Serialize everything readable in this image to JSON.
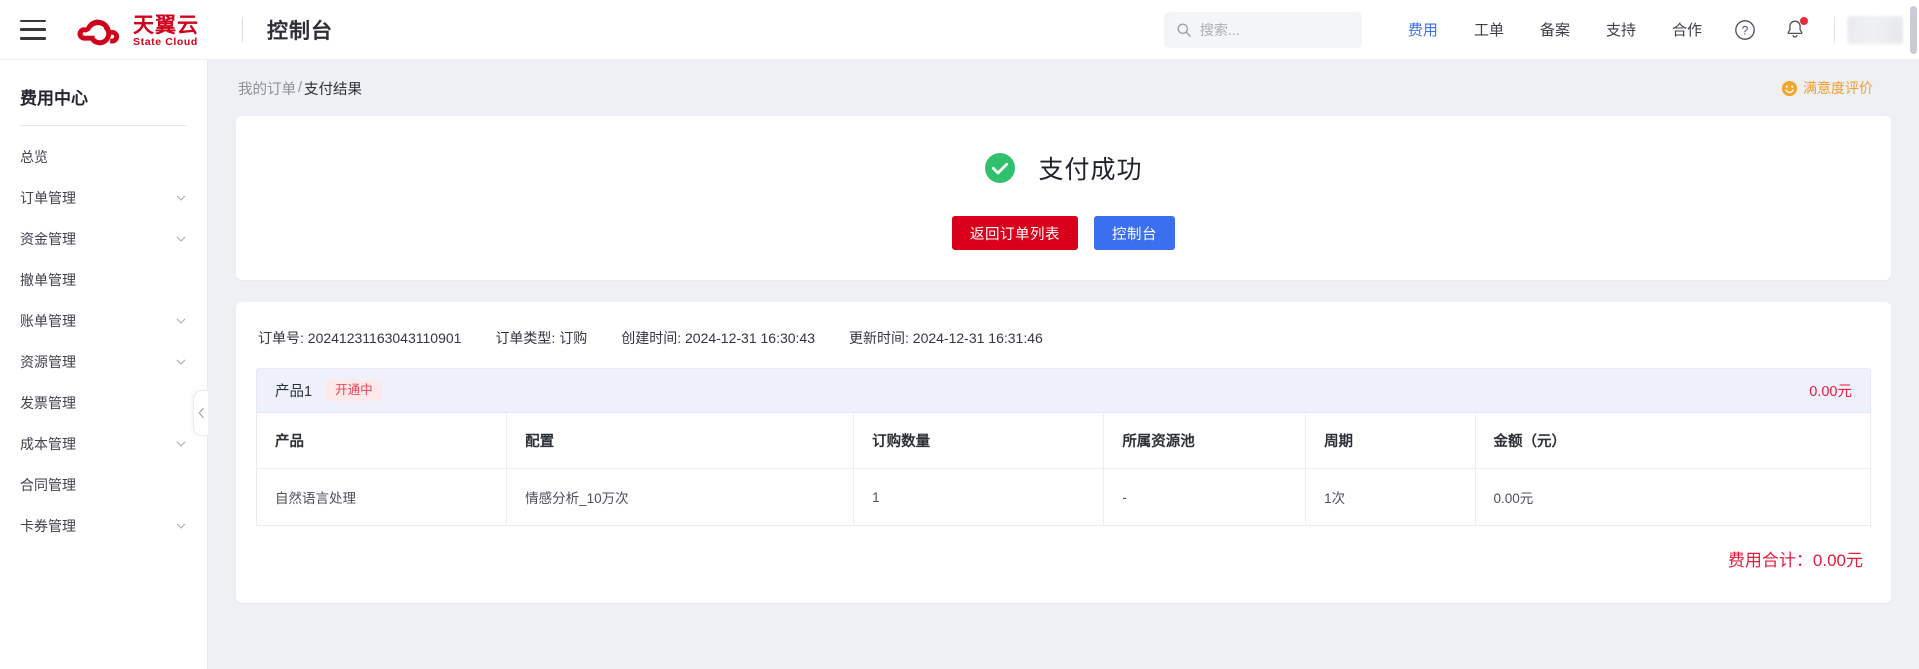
{
  "topbar": {
    "menu_icon": "hamburger-icon",
    "brand_primary": "天翼云",
    "brand_secondary": "State Cloud",
    "console_title": "控制台",
    "search": {
      "placeholder": "搜索...",
      "value": "",
      "icon": "search-icon"
    },
    "nav": [
      {
        "label": "费用",
        "active": true
      },
      {
        "label": "工单",
        "active": false
      },
      {
        "label": "备案",
        "active": false
      },
      {
        "label": "支持",
        "active": false
      },
      {
        "label": "合作",
        "active": false
      }
    ],
    "help_icon": "question-circle-icon",
    "notification_icon": "bell-icon",
    "has_notification": true,
    "avatar": "user-avatar"
  },
  "sidebar": {
    "title": "费用中心",
    "items": [
      {
        "label": "总览",
        "expandable": false
      },
      {
        "label": "订单管理",
        "expandable": true
      },
      {
        "label": "资金管理",
        "expandable": true
      },
      {
        "label": "撤单管理",
        "expandable": false
      },
      {
        "label": "账单管理",
        "expandable": true
      },
      {
        "label": "资源管理",
        "expandable": true
      },
      {
        "label": "发票管理",
        "expandable": false
      },
      {
        "label": "成本管理",
        "expandable": true
      },
      {
        "label": "合同管理",
        "expandable": false
      },
      {
        "label": "卡券管理",
        "expandable": true
      }
    ],
    "collapse_icon": "chevron-left-icon"
  },
  "breadcrumb": {
    "parent": "我的订单",
    "separator": "/",
    "current": "支付结果"
  },
  "satisfaction": {
    "label": "满意度评价",
    "icon": "smiley-icon",
    "color": "#f0a02a"
  },
  "result": {
    "status_icon": "check-circle-icon",
    "status_color": "#2fc06e",
    "title": "支付成功",
    "buttons": [
      {
        "label": "返回订单列表",
        "style": "primary-red",
        "color": "#d9001b"
      },
      {
        "label": "控制台",
        "style": "primary-blue",
        "color": "#3a6ff0"
      }
    ]
  },
  "order": {
    "meta": [
      {
        "label": "订单号:",
        "value": "20241231163043110901"
      },
      {
        "label": "订单类型:",
        "value": "订购"
      },
      {
        "label": "创建时间:",
        "value": "2024-12-31 16:30:43"
      },
      {
        "label": "更新时间:",
        "value": "2024-12-31 16:31:46"
      }
    ],
    "product_group": {
      "name": "产品1",
      "status_badge": "开通中",
      "badge_color": "#e8425a",
      "price": "0.00元"
    },
    "table": {
      "headers": [
        "产品",
        "配置",
        "订购数量",
        "所属资源池",
        "周期",
        "金额（元）"
      ],
      "rows": [
        {
          "product": "自然语言处理",
          "config": "情感分析_10万次",
          "quantity": "1",
          "resource_pool": "-",
          "period": "1次",
          "amount": "0.00元"
        }
      ]
    },
    "total_label": "费用合计：",
    "total_value": "0.00元",
    "total_color": "#e8193c"
  }
}
